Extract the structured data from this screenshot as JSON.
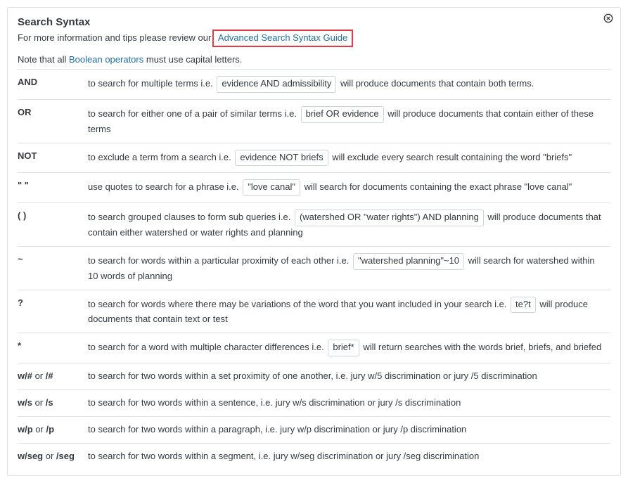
{
  "header": {
    "title": "Search Syntax",
    "intro_prefix": "For more information and tips please review our",
    "guide_link": "Advanced Search Syntax Guide"
  },
  "note": {
    "prefix": "Note that all ",
    "link": "Boolean operators",
    "suffix": " must use capital letters."
  },
  "rows": [
    {
      "op": "AND",
      "pre": "to search for multiple terms i.e. ",
      "example": "evidence AND admissibility",
      "post": " will produce documents that contain both terms."
    },
    {
      "op": "OR",
      "pre": "to search for either one of a pair of similar terms i.e. ",
      "example": "brief OR evidence",
      "post": " will produce documents that contain either of these terms"
    },
    {
      "op": "NOT",
      "pre": "to exclude a term from a search i.e. ",
      "example": "evidence NOT briefs",
      "post": " will exclude every search result containing the word \"briefs\""
    },
    {
      "op": "\" \"",
      "pre": "use quotes to search for a phrase i.e. ",
      "example": "\"love canal\"",
      "post": " will search for documents containing the exact phrase \"love canal\""
    },
    {
      "op": "( )",
      "pre": "to search grouped clauses to form sub queries i.e. ",
      "example": "(watershed OR \"water rights\") AND planning",
      "post": " will produce documents that contain either watershed or water rights and planning"
    },
    {
      "op": "~",
      "pre": "to search for words within a particular proximity of each other i.e. ",
      "example": "\"watershed planning\"~10",
      "post": " will search for watershed within 10 words of planning"
    },
    {
      "op": "?",
      "pre": "to search for words where there may be variations of the word that you want included in your search i.e. ",
      "example": "te?t",
      "post": " will produce documents that contain text or test"
    },
    {
      "op": "*",
      "pre": "to search for a word with multiple character differences i.e. ",
      "example": "brief*",
      "post": " will return searches with the words brief, briefs, and briefed"
    },
    {
      "op_bold": "w/#",
      "op_sep": " or ",
      "op_alt": "/#",
      "pre": "to search for two words within a set proximity of one another, i.e. jury w/5 discrimination or jury /5 discrimination"
    },
    {
      "op_bold": "w/s",
      "op_sep": " or ",
      "op_alt": "/s",
      "pre": "to search for two words within a sentence, i.e. jury w/s discrimination or jury /s discrimination"
    },
    {
      "op_bold": "w/p",
      "op_sep": " or ",
      "op_alt": "/p",
      "pre": "to search for two words within a paragraph, i.e. jury w/p discrimination or jury /p discrimination"
    },
    {
      "op_bold": "w/seg",
      "op_sep": " or ",
      "op_alt": "/seg",
      "pre": "to search for two words within a segment, i.e. jury w/seg discrimination or jury /seg discrimination"
    }
  ]
}
